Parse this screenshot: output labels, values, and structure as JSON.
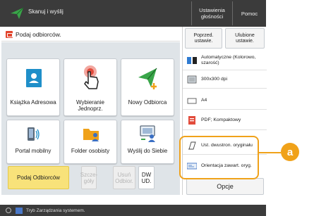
{
  "titlebar": {
    "title": "Skanuj i wyślij",
    "settings_label": "Ustawienia głośności",
    "help_label": "Pomoc"
  },
  "instruction": "Podaj odbiorców.",
  "tiles": [
    {
      "label": "Książka Adresowa",
      "icon": "address-book-icon"
    },
    {
      "label": "Wybieranie Jednoprz.",
      "icon": "one-touch-icon"
    },
    {
      "label": "Nowy Odbiorca",
      "icon": "new-destination-icon"
    },
    {
      "label": "Portal mobilny",
      "icon": "mobile-portal-icon"
    },
    {
      "label": "Folder osobisty",
      "icon": "personal-folder-icon"
    },
    {
      "label": "Wyślij do Siebie",
      "icon": "send-to-myself-icon"
    }
  ],
  "bottom_buttons": {
    "specify": "Podaj Odbiorców",
    "prev": "Szcze-góły",
    "remove": "Usuń Odbior.",
    "dwud": "DW UD."
  },
  "right_panel": {
    "prev_settings": "Poprzed. ustawie.",
    "favorites": "Ulubione ustawie.",
    "settings": [
      {
        "label": "Automatyczne (Kolorowo, szarość)",
        "icon": "color-mode-icon"
      },
      {
        "label": "300x300 dpi",
        "icon": "resolution-icon"
      },
      {
        "label": "A4",
        "icon": "paper-size-icon"
      },
      {
        "label": "PDF; Kompaktowy",
        "icon": "file-format-icon"
      },
      {
        "label": "Ust. dwustron. oryginału",
        "icon": "duplex-original-icon"
      },
      {
        "label": "Orientacja zawart. oryg.",
        "icon": "orientation-icon"
      }
    ],
    "options": "Opcje"
  },
  "callout": "a",
  "status": "Tryb Zarządzania systemem.",
  "colors": {
    "accent": "#f0a21a",
    "primary_button": "#f8e27a",
    "titlebar": "#3b3b3b",
    "panel": "#dfe4e8"
  }
}
